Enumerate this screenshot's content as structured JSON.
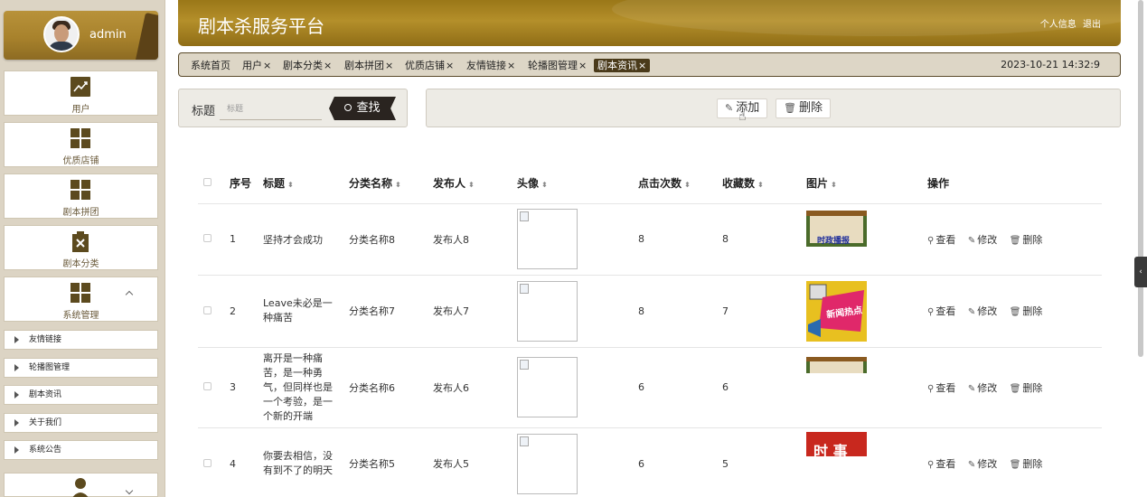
{
  "user": {
    "name": "admin"
  },
  "sidebar": {
    "tiles": [
      {
        "label": "用户",
        "icon": "trend-chart-icon"
      },
      {
        "label": "优质店铺",
        "icon": "grid-icon"
      },
      {
        "label": "剧本拼团",
        "icon": "grid-icon"
      },
      {
        "label": "剧本分类",
        "icon": "clipboard-x-icon"
      },
      {
        "label": "系统管理",
        "icon": "grid-icon"
      }
    ],
    "sub_items": [
      {
        "label": "友情链接"
      },
      {
        "label": "轮播图管理"
      },
      {
        "label": "剧本资讯"
      },
      {
        "label": "关于我们"
      },
      {
        "label": "系统公告"
      }
    ]
  },
  "header": {
    "title": "剧本杀服务平台",
    "profile_link": "个人信息",
    "logout_link": "退出"
  },
  "tabs": [
    {
      "label": "系统首页",
      "closable": false
    },
    {
      "label": "用户",
      "closable": true
    },
    {
      "label": "剧本分类",
      "closable": true
    },
    {
      "label": "剧本拼团",
      "closable": true
    },
    {
      "label": "优质店铺",
      "closable": true
    },
    {
      "label": "友情链接",
      "closable": true
    },
    {
      "label": "轮播图管理",
      "closable": true
    },
    {
      "label": "剧本资讯",
      "closable": true,
      "active": true
    }
  ],
  "tab_close_glyph": "×",
  "datetime": "2023-10-21 14:32:9",
  "search": {
    "label": "标题",
    "placeholder": "标题",
    "button_label": "查找"
  },
  "actions": {
    "add_label": "添加",
    "delete_label": "删除"
  },
  "table": {
    "headers": {
      "index": "序号",
      "title": "标题",
      "category": "分类名称",
      "publisher": "发布人",
      "avatar": "头像",
      "clicks": "点击次数",
      "favorites": "收藏数",
      "image": "图片",
      "operations": "操作"
    },
    "rows": [
      {
        "index": "1",
        "title": "坚持才会成功",
        "category": "分类名称8",
        "publisher": "发布人8",
        "clicks": "8",
        "favorites": "8",
        "image_text": "时政播报"
      },
      {
        "index": "2",
        "title": "Leave未必是一种痛苦",
        "category": "分类名称7",
        "publisher": "发布人7",
        "clicks": "8",
        "favorites": "7",
        "image_text": "新闻热点"
      },
      {
        "index": "3",
        "title": "离开是一种痛苦，是一种勇气，但同样也是一个考验，是一个新的开端",
        "category": "分类名称6",
        "publisher": "发布人6",
        "clicks": "6",
        "favorites": "6",
        "image_text": ""
      },
      {
        "index": "4",
        "title": "你要去相信，没有到不了的明天",
        "category": "分类名称5",
        "publisher": "发布人5",
        "clicks": "6",
        "favorites": "5",
        "image_text": "时 事"
      }
    ],
    "row_ops": {
      "view": "查看",
      "edit": "修改",
      "delete": "删除"
    }
  },
  "colors": {
    "brand_gold": "#a8822c",
    "dark_brown": "#4a3a1a"
  }
}
